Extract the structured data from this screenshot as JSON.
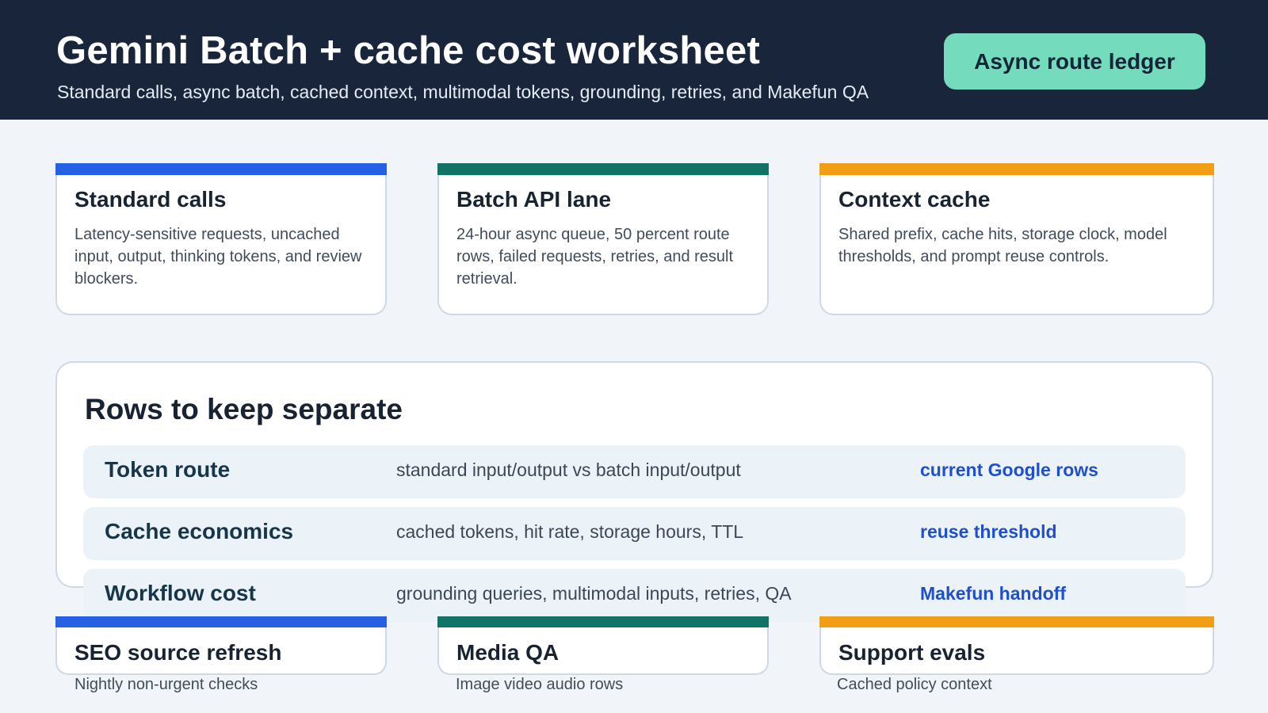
{
  "header": {
    "title": "Gemini Batch + cache cost worksheet",
    "subtitle": "Standard calls, async batch, cached context, multimodal tokens, grounding, retries, and Makefun QA",
    "badge": "Async route ledger"
  },
  "cards": [
    {
      "title": "Standard calls",
      "description": "Latency-sensitive requests, uncached input, output, thinking tokens, and review blockers.",
      "accent": "#2761e3"
    },
    {
      "title": "Batch API lane",
      "description": "24-hour async queue, 50 percent route rows, failed requests, retries, and result retrieval.",
      "accent": "#117366"
    },
    {
      "title": "Context cache",
      "description": "Shared prefix, cache hits, storage clock, model thresholds, and prompt reuse controls.",
      "accent": "#f09e16"
    }
  ],
  "rows_panel": {
    "title": "Rows to keep separate",
    "rows": [
      {
        "label": "Token route",
        "description": "standard input/output vs batch input/output",
        "link": "current Google rows"
      },
      {
        "label": "Cache economics",
        "description": "cached tokens, hit rate, storage hours, TTL",
        "link": "reuse threshold"
      },
      {
        "label": "Workflow cost",
        "description": "grounding queries, multimodal inputs, retries, QA",
        "link": "Makefun handoff"
      }
    ]
  },
  "use_cases": [
    {
      "title": "SEO source refresh",
      "caption": "Nightly non-urgent checks"
    },
    {
      "title": "Media QA",
      "caption": "Image video audio rows"
    },
    {
      "title": "Support evals",
      "caption": "Cached policy context"
    }
  ],
  "colors": {
    "header_bg": "#19253a",
    "badge_bg": "#74dcbd",
    "link": "#1f4fcf",
    "blue": "#2761e3",
    "teal": "#117366",
    "amber": "#f09e16"
  }
}
